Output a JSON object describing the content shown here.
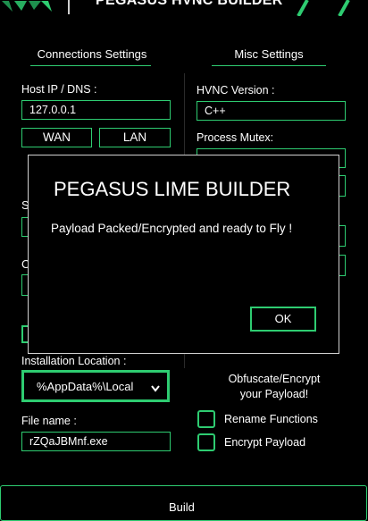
{
  "window": {
    "title": "PEGASUS HVNC BUILDER"
  },
  "sections": {
    "connections": "Connections Settings",
    "misc": "Misc Settings"
  },
  "host": {
    "label": "Host IP / DNS :",
    "value": "127.0.0.1",
    "wan_button": "WAN",
    "lan_button": "LAN"
  },
  "hvnc": {
    "label": "HVNC  Version :",
    "value": "C++"
  },
  "mutex": {
    "label": "Process Mutex:"
  },
  "install": {
    "label": "Installation Location :",
    "selected": "%AppData%\\Local"
  },
  "filename": {
    "label": "File name :",
    "value": "rZQaJBMnf.exe"
  },
  "obfuscate": {
    "heading_line1": "Obfuscate/Encrypt",
    "heading_line2": "your Payload!",
    "rename_label": "Rename Functions",
    "encrypt_label": "Encrypt Payload"
  },
  "build_button": "Build",
  "dialog": {
    "title": "PEGASUS LIME BUILDER",
    "message": "Payload Packed/Encrypted and ready to Fly !",
    "ok_button": "OK"
  },
  "colors": {
    "accent": "#2ecc71",
    "background": "#000000"
  },
  "icons": {
    "logo": "pegasus-logo-icon",
    "dropdown": "chevron-down-icon"
  }
}
